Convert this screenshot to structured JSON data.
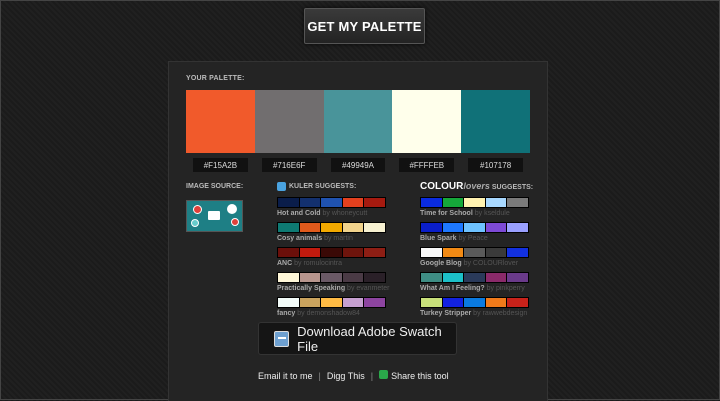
{
  "button_get": "GET MY PALETTE",
  "your_palette_label": "YOUR PALETTE:",
  "palette": [
    {
      "color": "#F15A2B",
      "hex": "#F15A2B"
    },
    {
      "color": "#716E6F",
      "hex": "#716E6F"
    },
    {
      "color": "#49949A",
      "hex": "#49949A"
    },
    {
      "color": "#FFFFEB",
      "hex": "#FFFFEB"
    },
    {
      "color": "#107178",
      "hex": "#107178"
    }
  ],
  "image_source_label": "IMAGE SOURCE:",
  "kuler_label": "KULER SUGGESTS:",
  "colourlovers": {
    "brand_bold": "COLOUR",
    "brand_light": "lovers",
    "suffix": "SUGGESTS:"
  },
  "kuler_suggestions": [
    {
      "name": "Hot and Cold",
      "by": "by whoneycutt",
      "colors": [
        "#0a1d4a",
        "#13306e",
        "#1f52b0",
        "#e3401e",
        "#a61a0f"
      ]
    },
    {
      "name": "Cosy animals",
      "by": "by martin",
      "colors": [
        "#0e7a73",
        "#e05a1c",
        "#f2a900",
        "#f1d38c",
        "#f7f1d1"
      ]
    },
    {
      "name": "ANC",
      "by": "by romulocintra",
      "colors": [
        "#6b0f0a",
        "#c21a0e",
        "#3a0906",
        "#6e140c",
        "#8e1e14"
      ]
    },
    {
      "name": "Practically Speaking",
      "by": "by evanmeter",
      "colors": [
        "#fff7d8",
        "#b8968e",
        "#6a5966",
        "#4a3a45",
        "#2a2028"
      ]
    },
    {
      "name": "fancy",
      "by": "by demonshadow84",
      "colors": [
        "#f2fbf8",
        "#c9a35e",
        "#ffbb44",
        "#c6a0d0",
        "#8d44a0"
      ]
    }
  ],
  "colour_suggestions": [
    {
      "name": "Time for School",
      "by": "by kseldule",
      "colors": [
        "#0a2be0",
        "#15a83a",
        "#fff2b0",
        "#a8d8ff",
        "#7a7a7a"
      ]
    },
    {
      "name": "Blue Spark",
      "by": "by Peace",
      "colors": [
        "#0a1ec8",
        "#1e78ff",
        "#6ec2ff",
        "#7e4ad6",
        "#9aa0ff"
      ]
    },
    {
      "name": "Google Blog",
      "by": "by COLOURlover",
      "colors": [
        "#f8f8f8",
        "#f28a14",
        "#5a5a5a",
        "#3a3a3a",
        "#1230e0"
      ]
    },
    {
      "name": "What Am I Feeling?",
      "by": "by pinkperry",
      "colors": [
        "#3e8d84",
        "#1cc0c8",
        "#2a3a5a",
        "#8a2a6a",
        "#6a3a8a"
      ]
    },
    {
      "name": "Turkey Stripper",
      "by": "by rawwebdesign",
      "colors": [
        "#c8e07a",
        "#1222e0",
        "#0a7ae0",
        "#f07a1a",
        "#c8221a"
      ]
    }
  ],
  "download_button": "Download Adobe Swatch File",
  "footer": {
    "email": "Email it to me",
    "sep1": "|",
    "digg": "Digg This",
    "sep2": "|",
    "share": "Share this tool"
  }
}
